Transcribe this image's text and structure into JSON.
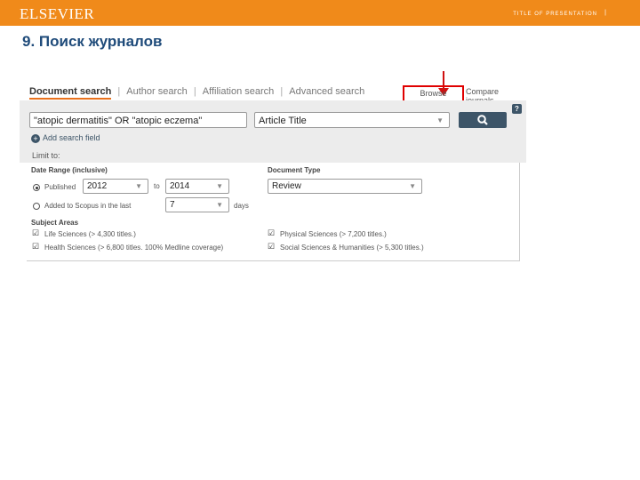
{
  "header": {
    "logo": "ELSEVIER",
    "presentation_title": "TITLE OF PRESENTATION",
    "separator": "|",
    "page_title": "9. Поиск журналов"
  },
  "tabs": [
    {
      "label": "Document search",
      "active": true
    },
    {
      "label": "Author search",
      "active": false
    },
    {
      "label": "Affiliation search",
      "active": false
    },
    {
      "label": "Advanced search",
      "active": false
    }
  ],
  "tab_separator": "|",
  "links": {
    "browse_sources": "Browse Sources",
    "compare_journals": "Compare journals"
  },
  "search": {
    "query": "\"atopic dermatitis\" OR \"atopic eczema\"",
    "field": "Article Title",
    "add_field": "Add search field",
    "limit_to": "Limit to:",
    "help": "?"
  },
  "date_range": {
    "heading": "Date Range (inclusive)",
    "published_label": "Published",
    "from_year": "2012",
    "to_label": "to",
    "to_year": "2014",
    "added_label": "Added to Scopus in the last",
    "days_value": "7",
    "days_label": "days"
  },
  "document_type": {
    "heading": "Document Type",
    "value": "Review"
  },
  "subject_areas": {
    "heading": "Subject Areas",
    "items": [
      "Life Sciences (> 4,300 titles.)",
      "Health Sciences (> 6,800 titles. 100% Medline coverage)",
      "Physical Sciences (> 7,200 titles.)",
      "Social Sciences & Humanities (> 5,300 titles.)"
    ]
  },
  "colors": {
    "brand_orange": "#f08a1a",
    "title_blue": "#1f4b7a",
    "highlight_red": "#e00000",
    "button_dark": "#3d5568"
  },
  "icons": {
    "search": "search-icon",
    "help": "help-icon",
    "add": "plus-circle-icon",
    "dropdown": "chevron-down-icon",
    "arrow": "arrow-down-icon"
  }
}
